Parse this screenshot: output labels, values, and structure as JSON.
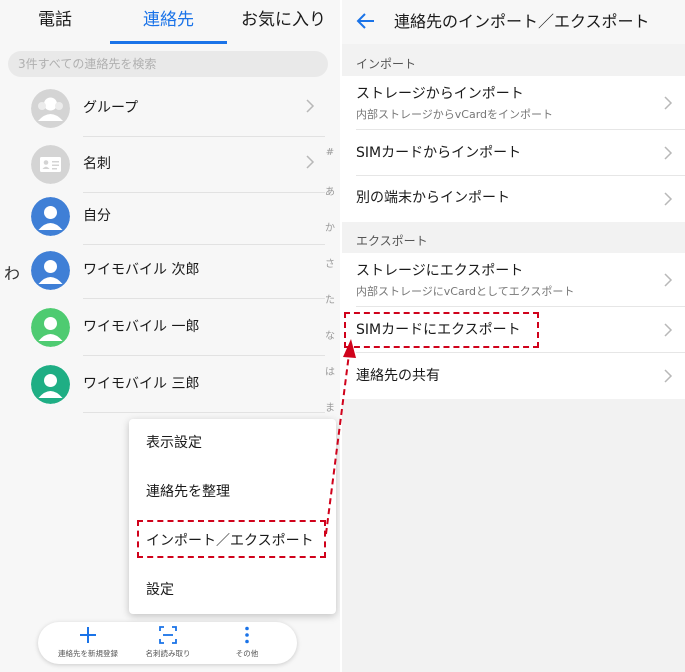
{
  "left": {
    "tabs": [
      "電話",
      "連絡先",
      "お気に入り"
    ],
    "search_placeholder": "3件すべての連絡先を検索",
    "rows": [
      {
        "name": "グループ",
        "icon": "group-avatar-icon"
      },
      {
        "name": "名刺",
        "icon": "business-card-icon"
      },
      {
        "name": "自分",
        "icon": "person-avatar-icon"
      },
      {
        "name": "ワイモバイル 次郎",
        "icon": "person-avatar-icon"
      },
      {
        "name": "ワイモバイル 一郎",
        "icon": "person-avatar-icon"
      },
      {
        "name": "ワイモバイル 三郎",
        "icon": "person-avatar-icon"
      }
    ],
    "index_letters": [
      "#",
      "あ",
      "か",
      "さ",
      "た",
      "な",
      "は",
      "ま"
    ],
    "section_letter": "わ",
    "menu": [
      "表示設定",
      "連絡先を整理",
      "インポート／エクスポート",
      "設定"
    ],
    "bottom_bar": [
      "連絡先を新規登録",
      "名刺読み取り",
      "その他"
    ]
  },
  "right": {
    "title": "連絡先のインポート／エクスポート",
    "import_header": "インポート",
    "import_items": [
      {
        "title": "ストレージからインポート",
        "sub": "内部ストレージからvCardをインポート"
      },
      {
        "title": "SIMカードからインポート"
      },
      {
        "title": "別の端末からインポート"
      }
    ],
    "export_header": "エクスポート",
    "export_items": [
      {
        "title": "ストレージにエクスポート",
        "sub": "内部ストレージにvCardとしてエクスポート"
      },
      {
        "title": "SIMカードにエクスポート"
      },
      {
        "title": "連絡先の共有"
      }
    ]
  },
  "colors": {
    "accent": "#1a73e8",
    "highlight": "#d0021b",
    "avatar_blue": "#3f7fd6",
    "avatar_green": "#4ecb71",
    "avatar_teal": "#1fae84",
    "avatar_gray": "#d4d4d4"
  }
}
